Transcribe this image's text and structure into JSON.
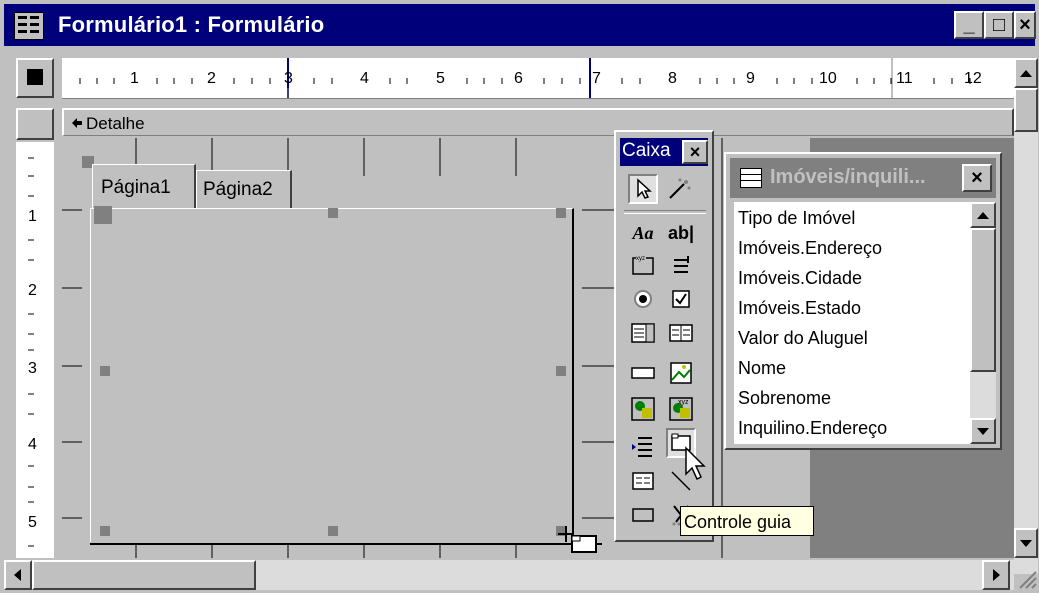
{
  "window": {
    "title": "Formulário1 : Formulário"
  },
  "titlebar": {
    "minimize": "_",
    "maximize": "□",
    "close": "×"
  },
  "ruler": {
    "top_numbers": [
      "1",
      "2",
      "3",
      "4",
      "5",
      "6",
      "7",
      "8",
      "9",
      "10",
      "11",
      "12"
    ],
    "left_numbers": [
      "1",
      "2",
      "3",
      "4",
      "5"
    ]
  },
  "section": {
    "label": "Detalhe"
  },
  "tabs": [
    "Página1",
    "Página2"
  ],
  "toolbox": {
    "title": "Caixa",
    "close": "×",
    "tooltip": "Controle guia"
  },
  "fieldlist": {
    "title": "Imóveis/inquili...",
    "close": "×",
    "items": [
      "Tipo de Imóvel",
      "Imóveis.Endereço",
      "Imóveis.Cidade",
      "Imóveis.Estado",
      "Valor do Aluguel",
      "Nome",
      "Sobrenome",
      "Inquilino.Endereço"
    ]
  },
  "icons": {
    "app": "form-icon",
    "section_marker": "section-arrow-icon",
    "pointer": "select-objects-icon",
    "wizard": "control-wizard-icon"
  }
}
